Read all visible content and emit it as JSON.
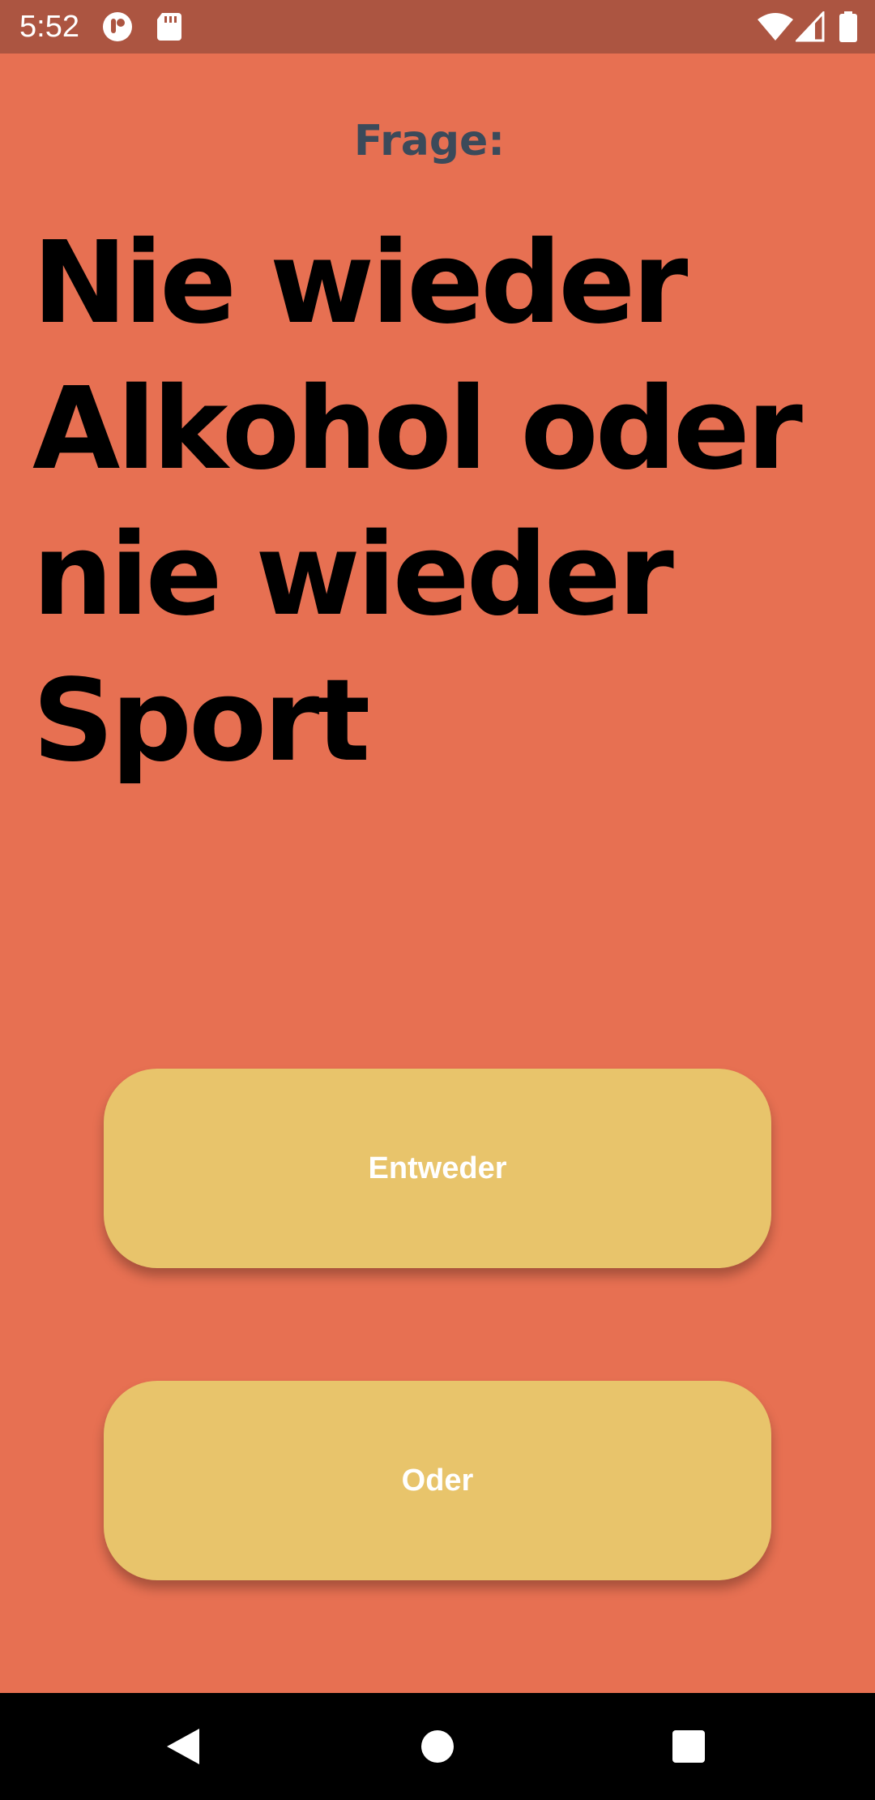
{
  "status_bar": {
    "time": "5:52",
    "icons": [
      "app-notification-icon",
      "sd-card-icon",
      "wifi-icon",
      "cell-signal-icon",
      "battery-icon"
    ]
  },
  "quiz": {
    "label": "Frage:",
    "question": "Nie wieder Alkohol oder nie wieder Sport",
    "option_a": "Entweder",
    "option_b": "Oder"
  },
  "nav_bar": {
    "icons": [
      "back-icon",
      "home-icon",
      "recents-icon"
    ]
  },
  "colors": {
    "background": "#E77052",
    "status_bar": "#AC5541",
    "button": "#E8C46B",
    "label": "#3B4A5A",
    "question": "#000000",
    "button_text": "#FFFFFF"
  }
}
